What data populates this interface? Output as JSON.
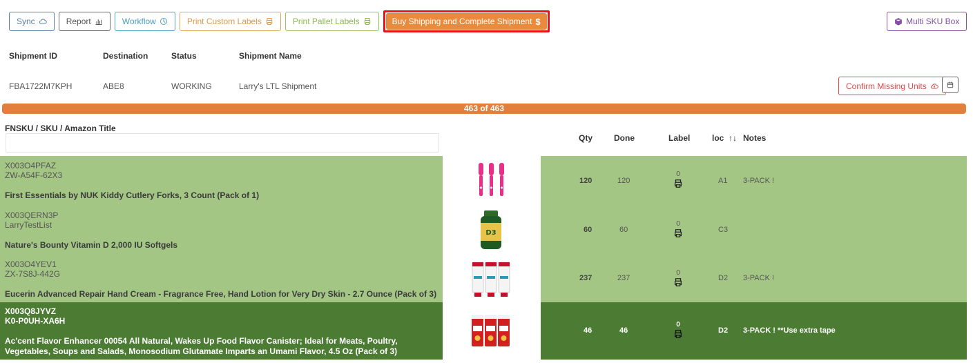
{
  "toolbar": {
    "sync": "Sync",
    "report": "Report",
    "workflow": "Workflow",
    "print_custom": "Print Custom Labels",
    "print_pallet": "Print Pallet Labels",
    "buy_shipping": "Buy Shipping and Complete Shipment",
    "multi_sku": "Multi SKU Box"
  },
  "shipment": {
    "headers": [
      "Shipment ID",
      "Destination",
      "Status",
      "Shipment Name"
    ],
    "id": "FBA1722M7KPH",
    "destination": "ABE8",
    "status": "WORKING",
    "name": "Larry's LTL Shipment",
    "confirm_label": "Confirm Missing Units"
  },
  "progress": {
    "label": "463 of 463",
    "fraction": 1.0
  },
  "table": {
    "columns": {
      "product": "FNSKU / SKU / Amazon Title",
      "qty": "Qty",
      "done": "Done",
      "label": "Label",
      "loc": "loc",
      "notes": "Notes"
    },
    "rows": [
      {
        "fnsku": "X003O4PFAZ",
        "sku": "ZW-A54F-62X3",
        "title": "First Essentials by NUK Kiddy Cutlery Forks, 3 Count (Pack of 1)",
        "image": "pink-forks",
        "qty": "120",
        "done": "120",
        "label_count": "0",
        "loc": "A1",
        "notes": "3-PACK !"
      },
      {
        "fnsku": "X003QERN3P",
        "sku": "LarryTestList",
        "title": "Nature's Bounty Vitamin D 2,000 IU Softgels",
        "image": "vitamin-bottle",
        "qty": "60",
        "done": "60",
        "label_count": "0",
        "loc": "C3",
        "notes": ""
      },
      {
        "fnsku": "X003O4YEV1",
        "sku": "ZX-7S8J-442G",
        "title": "Eucerin Advanced Repair Hand Cream - Fragrance Free, Hand Lotion for Very Dry Skin - 2.7 Ounce (Pack of 3)",
        "image": "hand-cream-tubes",
        "qty": "237",
        "done": "237",
        "label_count": "0",
        "loc": "D2",
        "notes": "3-PACK !"
      },
      {
        "fnsku": "X003Q8JYVZ",
        "sku": "K0-P0UH-XA6H",
        "title": "Ac'cent Flavor Enhancer 00054 All Natural, Wakes Up Food Flavor Canister; Ideal for Meats, Poultry, Vegetables, Soups and Salads, Monosodium Glutamate Imparts an Umami Flavor, 4.5 Oz (Pack of 3)",
        "image": "accent-canisters",
        "qty": "46",
        "done": "46",
        "label_count": "0",
        "loc": "D2",
        "notes": "3-PACK ! **Use extra tape"
      }
    ]
  },
  "colors": {
    "accent_orange": "#e27f3c",
    "row_done": "#a4c685",
    "row_selected": "#4c7c33",
    "highlight": "#e8121a"
  }
}
